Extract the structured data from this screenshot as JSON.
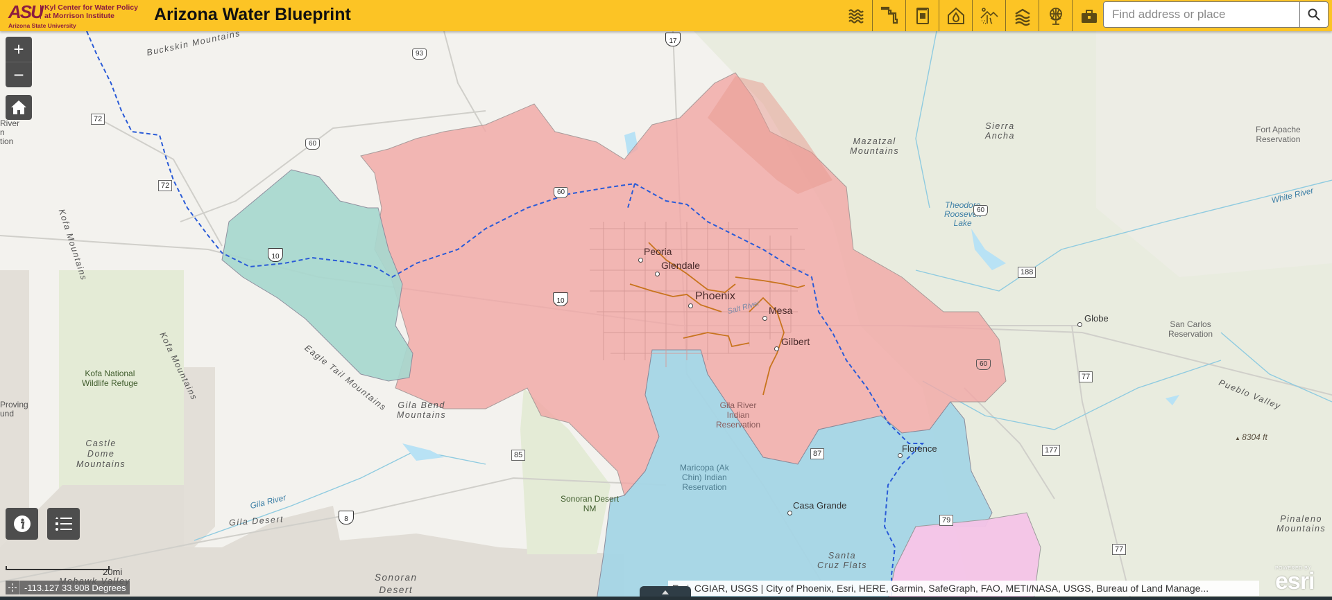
{
  "header": {
    "logo": {
      "mark": "ASU",
      "line1": "Kyl Center for Water Policy",
      "line2": "at Morrison Institute",
      "university": "Arizona State University"
    },
    "title": "Arizona Water Blueprint",
    "tools": [
      {
        "name": "water-waves-tool",
        "icon": "waves-icon"
      },
      {
        "name": "pipeline-tool",
        "icon": "pipeline-icon"
      },
      {
        "name": "policy-book-tool",
        "icon": "book-icon"
      },
      {
        "name": "home-water-tool",
        "icon": "house-drop-icon"
      },
      {
        "name": "watershed-tool",
        "icon": "watershed-icon"
      },
      {
        "name": "layers-tool",
        "icon": "layers-icon"
      },
      {
        "name": "globe-tool",
        "icon": "globe-icon"
      },
      {
        "name": "toolbox-tool",
        "icon": "toolbox-icon"
      }
    ],
    "search": {
      "placeholder": "Find address or place",
      "value": ""
    }
  },
  "map": {
    "controls": {
      "zoom_in": "+",
      "zoom_out": "−"
    },
    "scale": "20mi",
    "coordinates": "-113.127 33.908 Degrees",
    "attribution": "Esri, CGIAR, USGS | City of Phoenix, Esri, HERE, Garmin, SafeGraph, FAO, METI/NASA, USGS, Bureau of Land Manage...",
    "esri": {
      "powered": "POWERED BY",
      "name": "esri"
    },
    "colors": {
      "region_pink": "#f2b4b2",
      "region_teal": "#a8d8cf",
      "region_blue": "#a6d6e6",
      "region_magenta": "#f5c4e8",
      "canal": "#2a5bd7",
      "river_orange": "#c8741e",
      "header": "#fcc425"
    },
    "labels": {
      "mountains": [
        "Buckskin Mountains",
        "Kofa Mountains",
        "Kofa Mountains",
        "Eagle Tail Mountains",
        "Gila Bend\nMountains",
        "Castle\nDome\nMountains",
        "Mazatzal\nMountains",
        "Sierra\nAncha",
        "Pueblo Valley",
        "Pinaleno\nMountains",
        "Sonoran\nDesert",
        "Santa\nCruz Flats",
        "Gila Desert",
        "Mohawk Valley"
      ],
      "water": [
        "Gila River",
        "Salt River",
        "Theodore\nRoosevelt\nLake",
        "White River"
      ],
      "parks": [
        "Kofa National\nWildlife Refuge",
        "Sonoran Desert\nNM"
      ],
      "reservations": [
        "Fort Apache\nReservation",
        "San Carlos\nReservation",
        "Gila River\nIndian\nReservation",
        "Maricopa (Ak\nChin) Indian\nReservation"
      ],
      "cities": [
        "Peoria",
        "Glendale",
        "Phoenix",
        "Mesa",
        "Gilbert",
        "Globe",
        "Florence",
        "Casa Grande"
      ],
      "edge": [
        "River",
        "n",
        "tion",
        "Proving",
        "und"
      ],
      "elevation": "8304 ft",
      "highways": [
        "93",
        "72",
        "72",
        "60",
        "60",
        "60",
        "17",
        "10",
        "10",
        "188",
        "77",
        "77",
        "177",
        "85",
        "87",
        "79",
        "8"
      ]
    }
  }
}
